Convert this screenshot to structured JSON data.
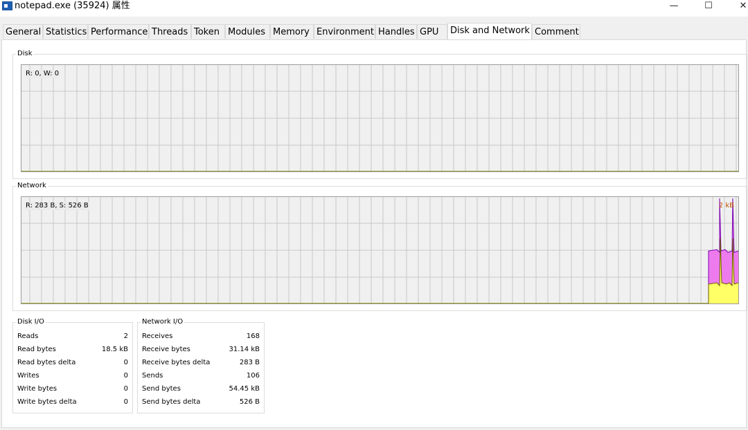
{
  "window": {
    "title": "notepad.exe (35924) 属性",
    "min_symbol": "—",
    "max_symbol": "☐",
    "close_symbol": "✕",
    "icon": "app-window-icon"
  },
  "tabs": [
    {
      "label": "General"
    },
    {
      "label": "Statistics"
    },
    {
      "label": "Performance"
    },
    {
      "label": "Threads"
    },
    {
      "label": "Token"
    },
    {
      "label": "Modules"
    },
    {
      "label": "Memory"
    },
    {
      "label": "Environment"
    },
    {
      "label": "Handles"
    },
    {
      "label": "GPU"
    },
    {
      "label": "Disk and Network",
      "active": true
    },
    {
      "label": "Comment"
    }
  ],
  "disk": {
    "group_label": "Disk",
    "graph_text": "R: 0, W: 0"
  },
  "network": {
    "group_label": "Network",
    "graph_text": "R: 283 B, S: 526 B",
    "scale_text": "2 kB"
  },
  "disk_io": {
    "label": "Disk I/O",
    "rows": [
      {
        "label": "Reads",
        "value": "2"
      },
      {
        "label": "Read bytes",
        "value": "18.5 kB"
      },
      {
        "label": "Read bytes delta",
        "value": "0"
      },
      {
        "label": "Writes",
        "value": "0"
      },
      {
        "label": "Write bytes",
        "value": "0"
      },
      {
        "label": "Write bytes delta",
        "value": "0"
      }
    ]
  },
  "network_io": {
    "label": "Network I/O",
    "rows": [
      {
        "label": "Receives",
        "value": "168"
      },
      {
        "label": "Receive bytes",
        "value": "31.14 kB"
      },
      {
        "label": "Receive bytes delta",
        "value": "283 B"
      },
      {
        "label": "Sends",
        "value": "106"
      },
      {
        "label": "Send bytes",
        "value": "54.45 kB"
      },
      {
        "label": "Send bytes delta",
        "value": "526 B"
      }
    ]
  },
  "colors": {
    "send_fill": "#ee7bee",
    "receive_fill": "#ffff66",
    "send_line": "#7a00b0",
    "receive_line": "#6b5a00",
    "grid": "#c8c8c8",
    "baseline": "#8a8a00"
  }
}
